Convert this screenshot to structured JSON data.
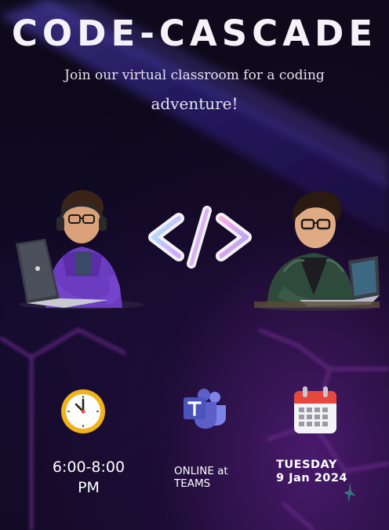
{
  "poster": {
    "title": "CODE-CASCADE",
    "subtitle_line1": "Join our virtual classroom for a coding",
    "subtitle_line2": "adventure!"
  },
  "details": {
    "time": {
      "icon": "clock-icon",
      "line1": "6:00-8:00",
      "line2": "PM"
    },
    "location": {
      "icon": "teams-icon",
      "line1": "ONLINE at",
      "line2": "TEAMS"
    },
    "date": {
      "icon": "calendar-icon",
      "line1": "TUESDAY",
      "line2": "9 Jan 2024"
    }
  },
  "illustrations": {
    "left": "teen-coder-purple-hoodie-illustration",
    "center": "code-brackets-icon",
    "right": "kid-coder-green-jacket-illustration"
  },
  "colors": {
    "background": "#0b0716",
    "glow_band": "#3a2a9a",
    "hex_lines": "#6a2a8a",
    "title": "#f4f2f8",
    "clock_rim": "#f2b21b",
    "teams_purple": "#5b5fc7",
    "calendar_red": "#e8473f"
  }
}
